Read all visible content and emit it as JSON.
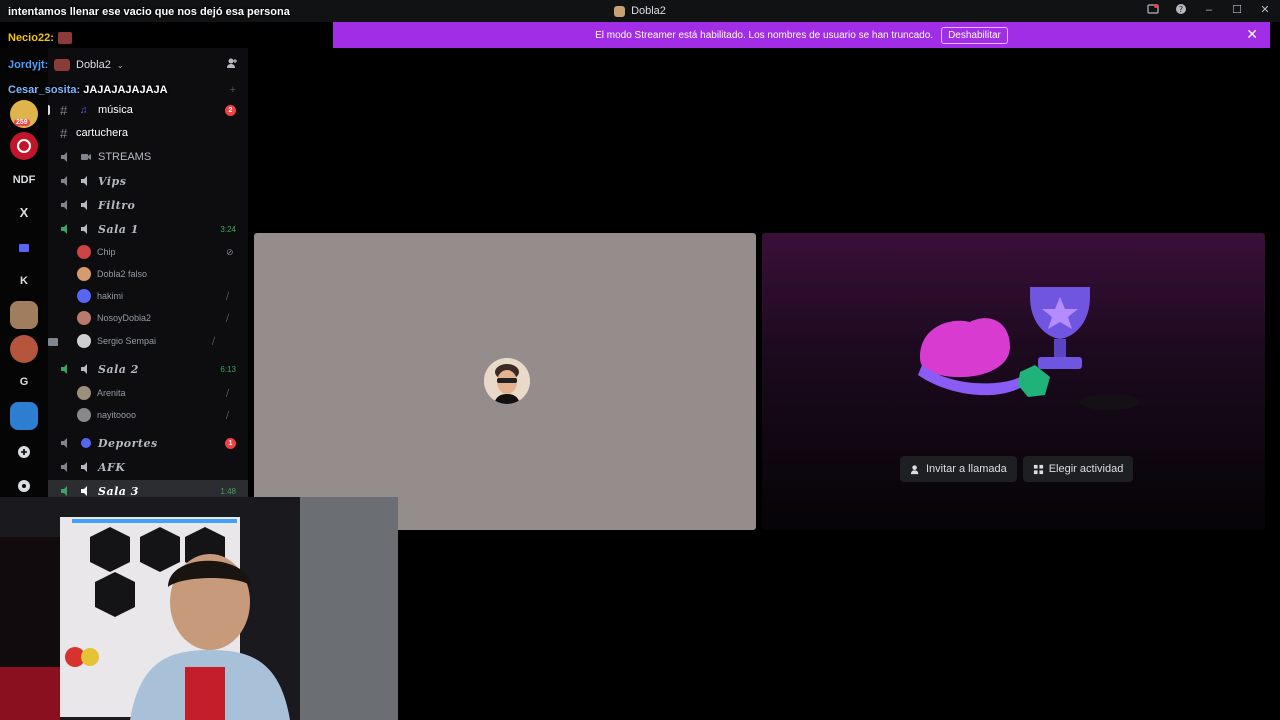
{
  "titlebar": {
    "title": "Dobla2"
  },
  "banner": {
    "message": "El modo Streamer está habilitado. Los nombres de usuario se han truncado.",
    "button": "Deshabilitar"
  },
  "chat": {
    "lines": [
      {
        "text": "intentamos llenar ese vacio que nos dejó esa persona"
      },
      {
        "name": "Necio22:",
        "text": ""
      },
      {
        "name": "Jordyjt:",
        "text": ""
      },
      {
        "name": "Cesar_sosita:",
        "text": "JAJAJAJAJAJA"
      }
    ]
  },
  "rail": {
    "labels": {
      "ndf": "NDF",
      "x": "X",
      "k": "K",
      "g": "G"
    },
    "badge_259": "259"
  },
  "guild": {
    "name": "Dobla2"
  },
  "channels": [
    {
      "name": "música",
      "badge": "2"
    },
    {
      "name": "cartuchera"
    },
    {
      "name": "STREAMS"
    },
    {
      "name": "Vips"
    },
    {
      "name": "Filtro"
    },
    {
      "name": "Sala 1",
      "timer": "3:24"
    },
    {
      "name": "Sala 2",
      "timer": "6:13"
    },
    {
      "name": "Deportes",
      "badge": "1"
    },
    {
      "name": "AFK"
    },
    {
      "name": "Sala 3",
      "timer": "1:48"
    }
  ],
  "sala1_users": [
    "Chip",
    "Dobla2 falso",
    "hakimi",
    "NosoyDobla2",
    "Sergio Sempai"
  ],
  "sala2_users": [
    "Arenita",
    "nayitoooo"
  ],
  "call": {
    "invite_label": "Invitar a llamada",
    "activity_label": "Elegir actividad"
  },
  "colors": {
    "banner": "#a12ee6",
    "accent_green": "#3ba55d",
    "badge_red": "#f23f43"
  }
}
